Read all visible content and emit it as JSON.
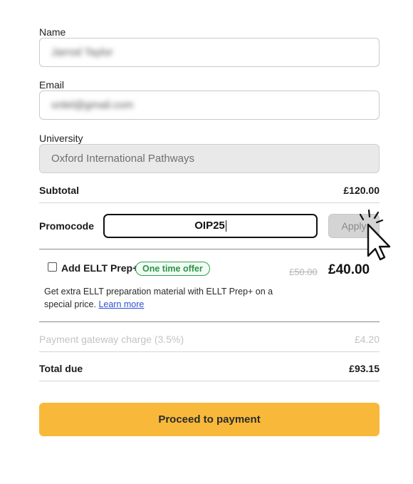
{
  "form": {
    "name": {
      "label": "Name",
      "value": "Jarrod Taylor"
    },
    "email": {
      "label": "Email",
      "value": "onlel@gmail.com"
    },
    "university": {
      "label": "University",
      "value": "Oxford International Pathways"
    }
  },
  "summary": {
    "subtotal_label": "Subtotal",
    "subtotal_value": "£120.00",
    "promocode_label": "Promocode",
    "promocode_value": "OIP25",
    "apply_label": "Apply"
  },
  "addon": {
    "checked": false,
    "title": "Add ELLT Prep+",
    "badge": "One time offer",
    "old_price": "£50.00",
    "new_price": "£40.00",
    "description": "Get extra ELLT preparation material with ELLT Prep+ on a special price.",
    "link_text": "Learn more"
  },
  "fees": {
    "gateway_label": "Payment gateway charge (3.5%)",
    "gateway_value": "£4.20",
    "total_label": "Total due",
    "total_value": "£93.15"
  },
  "cta": {
    "label": "Proceed to payment"
  },
  "icons": {
    "pointer": "hand-pointer-click-icon"
  },
  "colors": {
    "accent": "#f8b93b",
    "offer_green": "#2a9446",
    "link_blue": "#2f4fd6"
  }
}
